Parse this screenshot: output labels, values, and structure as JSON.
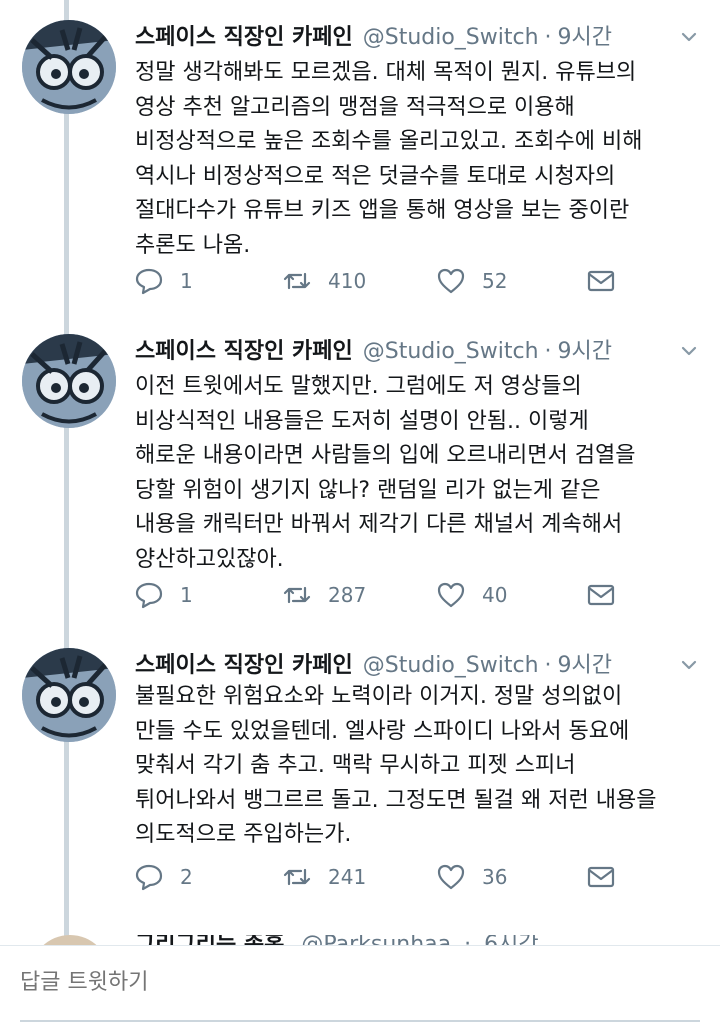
{
  "tweets": [
    {
      "name": "스페이스 직장인 카페인",
      "handle": "@Studio_Switch",
      "time": "9시간",
      "text": "정말 생각해봐도 모르겠음. 대체 목적이 뭔지. 유튜브의\n영상 추천 알고리즘의 맹점을 적극적으로 이용해\n비정상적으로 높은 조회수를 올리고있고. 조회수에 비해\n역시나 비정상적으로 적은 덧글수를 토대로 시청자의\n절대다수가 유튜브 키즈 앱을 통해 영상을 보는 중이란\n추론도 나옴.",
      "replies": "1",
      "retweets": "410",
      "likes": "52"
    },
    {
      "name": "스페이스 직장인 카페인",
      "handle": "@Studio_Switch",
      "time": "9시간",
      "text": "이전 트윗에서도 말했지만. 그럼에도 저 영상들의\n비상식적인 내용들은 도저히 설명이 안됨.. 이렇게\n해로운 내용이라면 사람들의 입에 오르내리면서 검열을\n당할 위험이 생기지 않나? 랜덤일 리가 없는게 같은\n내용을 캐릭터만 바꿔서 제각기 다른 채널서 계속해서\n양산하고있잖아.",
      "replies": "1",
      "retweets": "287",
      "likes": "40"
    },
    {
      "name": "스페이스 직장인 카페인",
      "handle": "@Studio_Switch",
      "time": "9시간",
      "text": "불필요한 위험요소와 노력이라 이거지. 정말 성의없이\n만들 수도 있었을텐데. 엘사랑 스파이디 나와서 동요에\n맞춰서 각기 춤 추고. 맥락 무시하고 피젯 스피너\n튀어나와서 뱅그르르 돌고. 그정도면 될걸 왜 저런 내용을\n의도적으로 주입하는가.",
      "replies": "2",
      "retweets": "241",
      "likes": "36"
    }
  ],
  "partial_tweet": {
    "name": "그리그리는 존홍",
    "handle": "@Parksunhaa",
    "time": "6시간"
  },
  "reply": {
    "placeholder": "답글 트윗하기"
  },
  "colors": {
    "text": "#14171a",
    "secondary": "#657786",
    "thread_line": "#ccd6dd"
  }
}
